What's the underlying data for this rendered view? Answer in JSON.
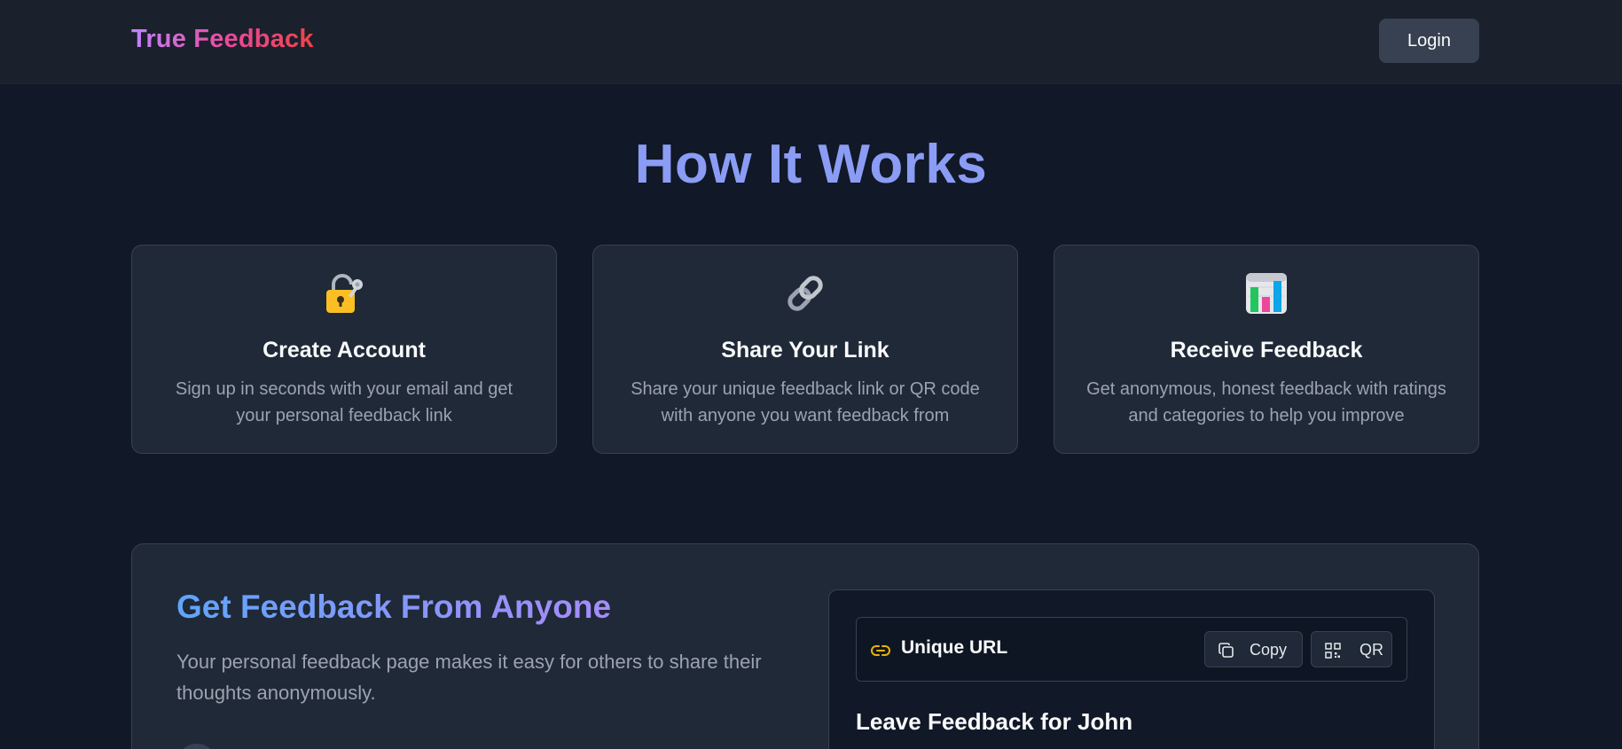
{
  "header": {
    "brand": "True Feedback",
    "login_label": "Login"
  },
  "how_it_works": {
    "title": "How It Works",
    "cards": [
      {
        "icon": "lock-key-icon",
        "title": "Create Account",
        "description": "Sign up in seconds with your email and get your personal feedback link"
      },
      {
        "icon": "link-icon",
        "title": "Share Your Link",
        "description": "Share your unique feedback link or QR code with anyone you want feedback from"
      },
      {
        "icon": "bar-chart-icon",
        "title": "Receive Feedback",
        "description": "Get anonymous, honest feedback with ratings and categories to help you improve"
      }
    ]
  },
  "get_feedback": {
    "title": "Get Feedback From Anyone",
    "description": "Your personal feedback page makes it easy for others to share their thoughts anonymously.",
    "preview": {
      "url_label": "Unique URL",
      "copy_label": "Copy",
      "qr_label": "QR",
      "leave_title": "Leave Feedback for John"
    }
  },
  "colors": {
    "background": "#111827",
    "card": "#1f2937",
    "accent_title": "#8b9cf5",
    "brand_gradient": [
      "#c084fc",
      "#ec4899",
      "#ef4444"
    ],
    "link_icon": "#eab308"
  }
}
